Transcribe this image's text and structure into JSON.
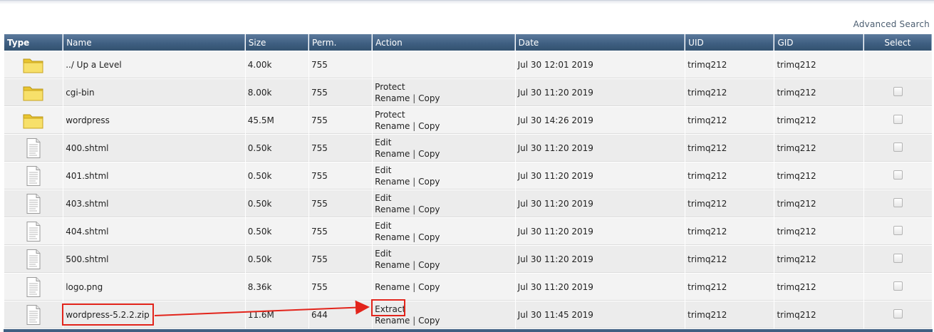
{
  "advanced_search": "Advanced Search",
  "columns": {
    "type": "Type",
    "name": "Name",
    "size": "Size",
    "perm": "Perm.",
    "action": "Action",
    "date": "Date",
    "uid": "UID",
    "gid": "GID",
    "select": "Select"
  },
  "rows": [
    {
      "icon": "folder-up-icon",
      "name": "../ Up a Level",
      "size": "4.00k",
      "perm": "755",
      "action1": "",
      "action2": "",
      "sep": "",
      "action3": "",
      "date": "Jul 30 12:01 2019",
      "uid": "trimq212",
      "gid": "trimq212",
      "selectable": false
    },
    {
      "icon": "folder-icon",
      "name": "cgi-bin",
      "size": "8.00k",
      "perm": "755",
      "action1": "Protect",
      "action2": "Rename",
      "sep": "|",
      "action3": "Copy",
      "date": "Jul 30 11:20 2019",
      "uid": "trimq212",
      "gid": "trimq212",
      "selectable": true
    },
    {
      "icon": "folder-icon",
      "name": "wordpress",
      "size": "45.5M",
      "perm": "755",
      "action1": "Protect",
      "action2": "Rename",
      "sep": "|",
      "action3": "Copy",
      "date": "Jul 30 14:26 2019",
      "uid": "trimq212",
      "gid": "trimq212",
      "selectable": true
    },
    {
      "icon": "file-icon",
      "name": "400.shtml",
      "size": "0.50k",
      "perm": "755",
      "action1": "Edit",
      "action2": "Rename",
      "sep": "|",
      "action3": "Copy",
      "date": "Jul 30 11:20 2019",
      "uid": "trimq212",
      "gid": "trimq212",
      "selectable": true
    },
    {
      "icon": "file-icon",
      "name": "401.shtml",
      "size": "0.50k",
      "perm": "755",
      "action1": "Edit",
      "action2": "Rename",
      "sep": "|",
      "action3": "Copy",
      "date": "Jul 30 11:20 2019",
      "uid": "trimq212",
      "gid": "trimq212",
      "selectable": true
    },
    {
      "icon": "file-icon",
      "name": "403.shtml",
      "size": "0.50k",
      "perm": "755",
      "action1": "Edit",
      "action2": "Rename",
      "sep": "|",
      "action3": "Copy",
      "date": "Jul 30 11:20 2019",
      "uid": "trimq212",
      "gid": "trimq212",
      "selectable": true
    },
    {
      "icon": "file-icon",
      "name": "404.shtml",
      "size": "0.50k",
      "perm": "755",
      "action1": "Edit",
      "action2": "Rename",
      "sep": "|",
      "action3": "Copy",
      "date": "Jul 30 11:20 2019",
      "uid": "trimq212",
      "gid": "trimq212",
      "selectable": true
    },
    {
      "icon": "file-icon",
      "name": "500.shtml",
      "size": "0.50k",
      "perm": "755",
      "action1": "Edit",
      "action2": "Rename",
      "sep": "|",
      "action3": "Copy",
      "date": "Jul 30 11:20 2019",
      "uid": "trimq212",
      "gid": "trimq212",
      "selectable": true
    },
    {
      "icon": "file-icon",
      "name": "logo.png",
      "size": "8.36k",
      "perm": "755",
      "action1": "",
      "action2": "Rename",
      "sep": "|",
      "action3": "Copy",
      "date": "Jul 30 11:20 2019",
      "uid": "trimq212",
      "gid": "trimq212",
      "selectable": true
    },
    {
      "icon": "file-icon",
      "name": "wordpress-5.2.2.zip",
      "size": "11.6M",
      "perm": "644",
      "action1": "Extract",
      "action2": "Rename",
      "sep": "|",
      "action3": "Copy",
      "date": "Jul 30 11:45 2019",
      "uid": "trimq212",
      "gid": "trimq212",
      "selectable": true
    }
  ],
  "colors": {
    "header_bg": "#3f5f82",
    "row_bg": "#f3f3f3",
    "annotation": "#e2241b",
    "folder": "#f2d64b"
  }
}
